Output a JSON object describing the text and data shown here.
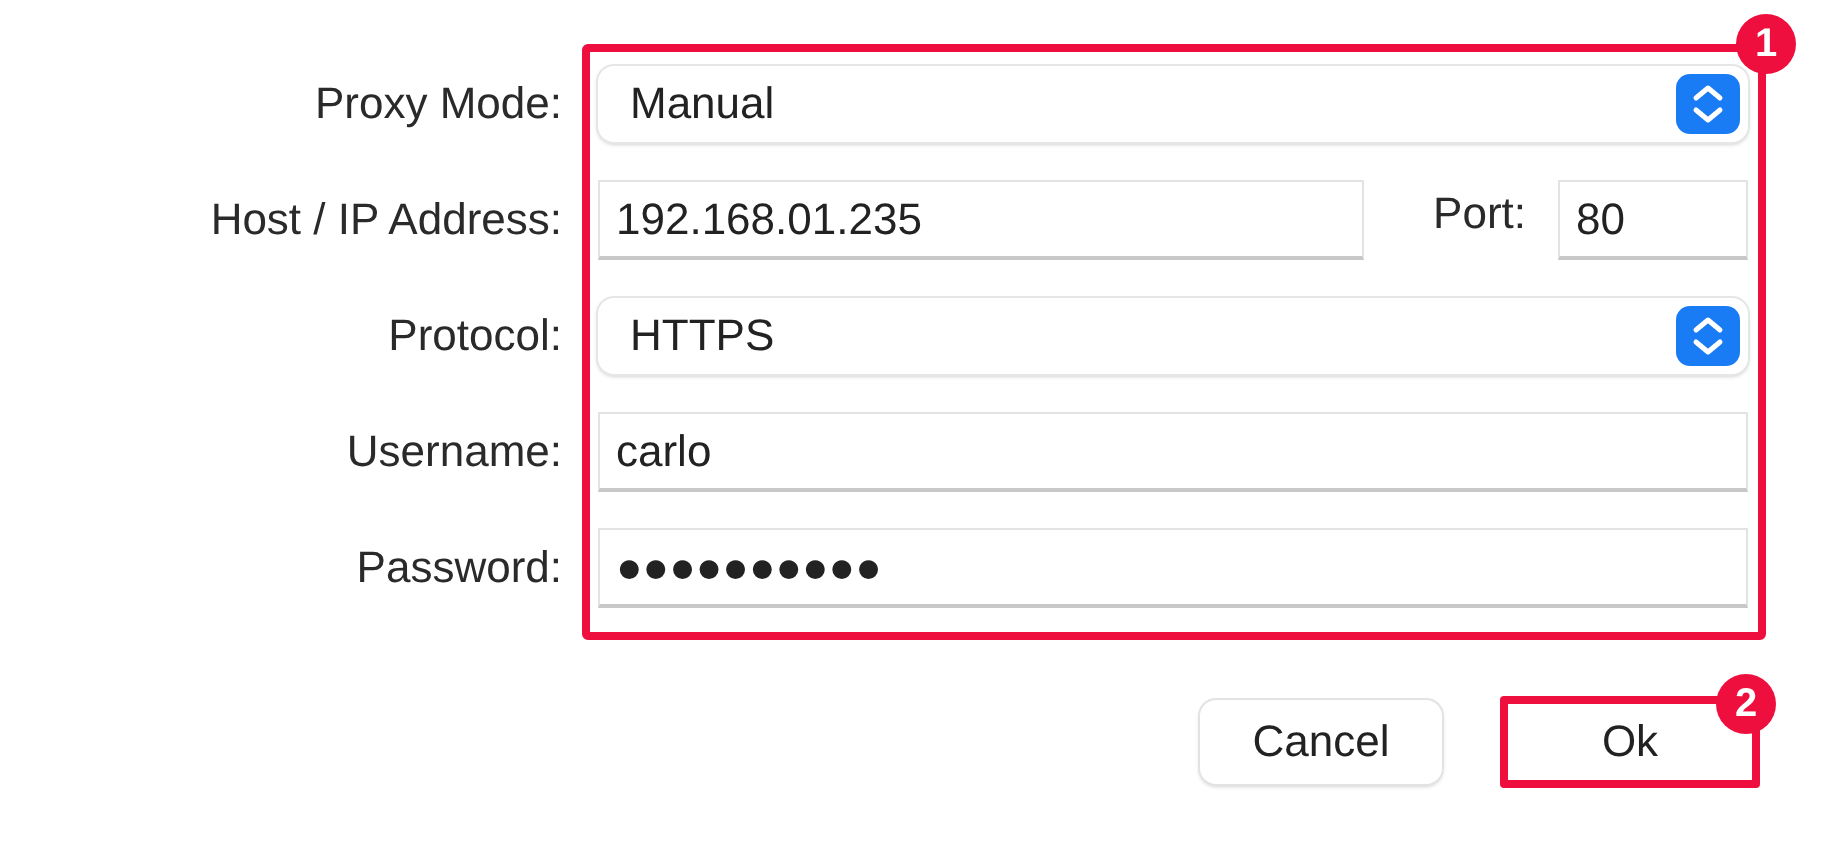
{
  "form": {
    "fields": [
      {
        "kind": "select",
        "label": "Proxy Mode:",
        "value": "Manual"
      },
      {
        "kind": "host",
        "label": "Host / IP Address:",
        "value": "192.168.01.235",
        "port_label": "Port:",
        "port_value": "80"
      },
      {
        "kind": "select",
        "label": "Protocol:",
        "value": "HTTPS"
      },
      {
        "kind": "text",
        "label": "Username:",
        "value": "carlo"
      },
      {
        "kind": "password",
        "label": "Password:",
        "value": "●●●●●●●●●●"
      }
    ]
  },
  "buttons": [
    {
      "label": "Cancel",
      "highlighted": false
    },
    {
      "label": "Ok",
      "highlighted": true
    }
  ],
  "callouts": [
    {
      "number": "1"
    },
    {
      "number": "2"
    }
  ]
}
